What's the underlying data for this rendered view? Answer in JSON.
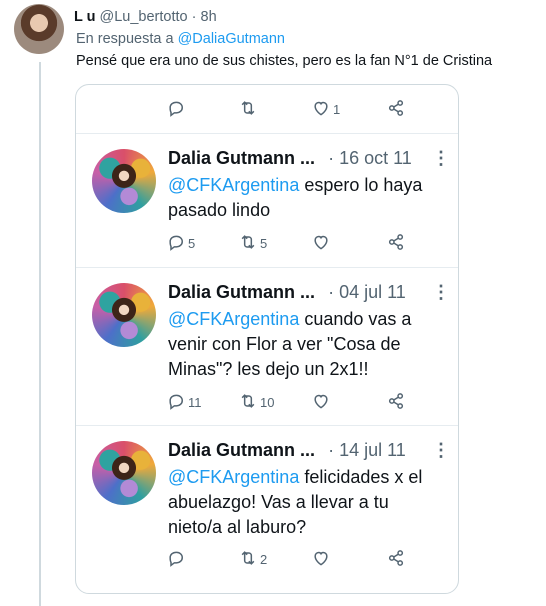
{
  "reply": {
    "name": "L u",
    "handle": "@Lu_bertotto",
    "separator": "·",
    "time": "8h",
    "replying_prefix": "En respuesta a",
    "replying_handle": "@DaliaGutmann",
    "text": "Pensé que era uno de sus chistes, pero es la fan N°1 de Cristina"
  },
  "embed": {
    "top_actions": {
      "reply_count": "",
      "retweet_count": "",
      "like_count": "1"
    },
    "tweets": [
      {
        "name": "Dalia Gutmann",
        "ellipsis": "...",
        "date": "· 16 oct 11",
        "more": "⋮",
        "mention": "@CFKArgentina",
        "text": " espero lo haya pasado lindo",
        "reply_count": "5",
        "retweet_count": "5",
        "like_count": ""
      },
      {
        "name": "Dalia Gutmann",
        "ellipsis": "...",
        "date": "· 04 jul 11",
        "more": "⋮",
        "mention": "@CFKArgentina",
        "text": " cuando vas a venir con Flor a ver \"Cosa de Minas\"? les dejo un 2x1!!",
        "reply_count": "11",
        "retweet_count": "10",
        "like_count": ""
      },
      {
        "name": "Dalia Gutmann",
        "ellipsis": "...",
        "date": "· 14 jul 11",
        "more": "⋮",
        "mention": "@CFKArgentina",
        "text": " felicidades x el abuelazgo! Vas a llevar a tu nieto/a al laburo?",
        "reply_count": "",
        "retweet_count": "2",
        "like_count": ""
      }
    ]
  },
  "icons": {
    "reply": "reply-icon",
    "retweet": "retweet-icon",
    "like": "heart-icon",
    "share": "share-icon"
  },
  "colors": {
    "link": "#1d9bf0",
    "secondary_text": "#536471",
    "border": "#cfd9de"
  }
}
